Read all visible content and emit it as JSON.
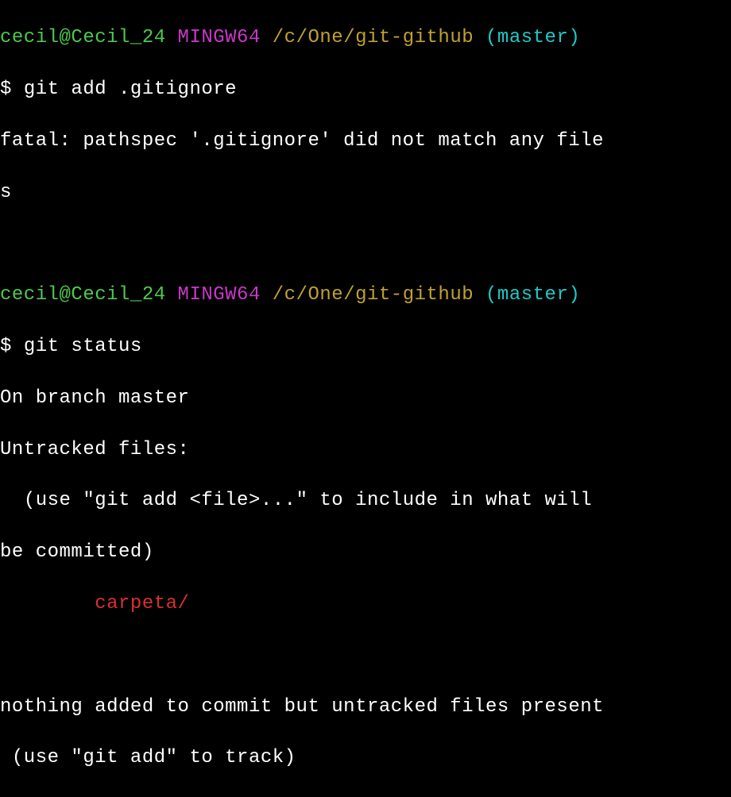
{
  "prompt1": {
    "user_host": "cecil@Cecil_24",
    "system": "MINGW64",
    "path": "/c/One/git-github",
    "branch": "(master)"
  },
  "cmd1": {
    "symbol": "$ ",
    "command": "git add .gitignore"
  },
  "out1": {
    "line1": "fatal: pathspec '.gitignore' did not match any file",
    "line2": "s"
  },
  "prompt2": {
    "user_host": "cecil@Cecil_24",
    "system": "MINGW64",
    "path": "/c/One/git-github",
    "branch": "(master)"
  },
  "cmd2": {
    "symbol": "$ ",
    "command": "git status"
  },
  "out2": {
    "line1": "On branch master",
    "line2": "Untracked files:",
    "line3": "  (use \"git add <file>...\" to include in what will ",
    "line4": "be committed)",
    "untracked_indent": "        ",
    "untracked": "carpeta/",
    "line6": "nothing added to commit but untracked files present",
    "line7": " (use \"git add\" to track)"
  }
}
